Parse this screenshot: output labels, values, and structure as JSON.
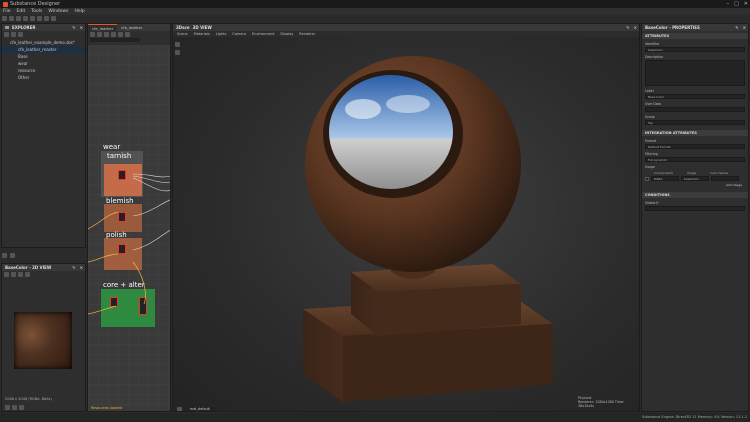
{
  "app": {
    "title": "Substance Designer",
    "window_controls": [
      "–",
      "□",
      "✕"
    ]
  },
  "menu": [
    "File",
    "Edit",
    "Tools",
    "Windows",
    "Help"
  ],
  "explorer": {
    "title": "EXPLORER",
    "package": "cfe_leather_example_demo.sbs*",
    "graph": "cfe_leather_master",
    "folders": [
      "Base",
      "wear",
      "resource",
      "Other"
    ]
  },
  "graph_tabs": [
    "cfe_leather",
    "cfe_leather"
  ],
  "graph_frames": [
    "wear",
    "tarnish",
    "blemish",
    "polish",
    "core + alter"
  ],
  "graph_footer": "Resources loaded",
  "preview2d": {
    "title": "BaseColor - 2D VIEW",
    "info": "2048 x 2048 (RGBA, 8bits)"
  },
  "viewport": {
    "title": "3D VIEW",
    "tab_prefix": "3Dsce",
    "menu": [
      "Scene",
      "Materials",
      "Lights",
      "Camera",
      "Environment",
      "Display",
      "Renderer"
    ],
    "stats_label": "Physical",
    "stats_line": "Renderer: 1280x1280 Time: 38x10x5s",
    "bottom_field": "mat_default"
  },
  "properties": {
    "title": "BaseColor - PROPERTIES",
    "sections": {
      "attributes": "ATTRIBUTES",
      "integration": "INTEGRATION ATTRIBUTES",
      "conditions": "CONDITIONS"
    },
    "identifier_label": "Identifier",
    "identifier_value": "baseColor",
    "description_label": "Description",
    "label_label": "Label",
    "label_value": "Base Color",
    "user_data_label": "User Data",
    "group_label": "Group",
    "group_value": "Top",
    "format_label": "Format",
    "format_value": "Default Format",
    "filtering_label": "Filtering",
    "filtering_value": "Full pyramid",
    "usage_label": "Usage",
    "components_label": "Components",
    "usage2_label": "Usage",
    "color_space_label": "Color Space",
    "components_value": "RGBA",
    "usage_value": "baseColor",
    "add_usage": "Add Usage",
    "visible_if_label": "Visible If"
  },
  "status": "Substance Engine: Direct3D 11  Memory: 4%  Version: 11.1.2"
}
